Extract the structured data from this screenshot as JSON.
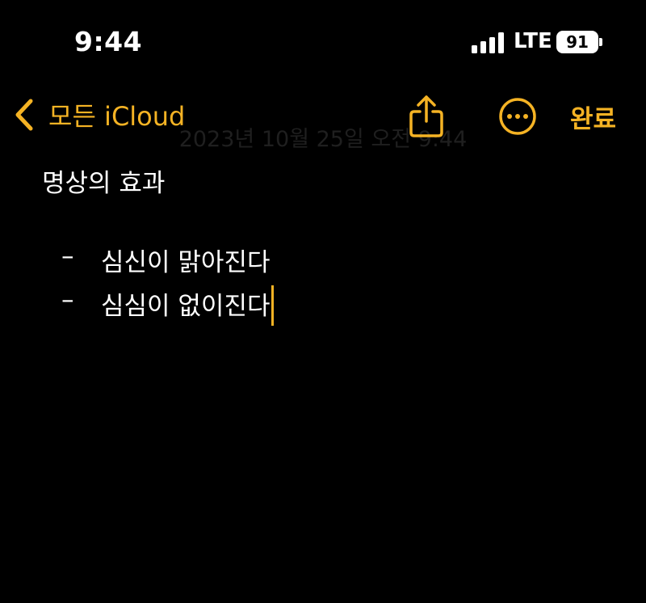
{
  "status_bar": {
    "time": "9:44",
    "network": "LTE",
    "battery": "91"
  },
  "nav": {
    "back_label": "모든 iCloud",
    "done_label": "완료",
    "share_icon": "share-icon",
    "more_icon": "ellipsis-circle-icon",
    "back_icon": "chevron-left-icon"
  },
  "note": {
    "date": "2023년 10월 25일 오전 9:44",
    "title": "명상의 효과",
    "bullet": "–",
    "items": [
      "심신이 맑아진다",
      "심심이 없이진다"
    ]
  },
  "colors": {
    "accent": "#f5b324",
    "background": "#000000",
    "text": "#ffffff"
  }
}
